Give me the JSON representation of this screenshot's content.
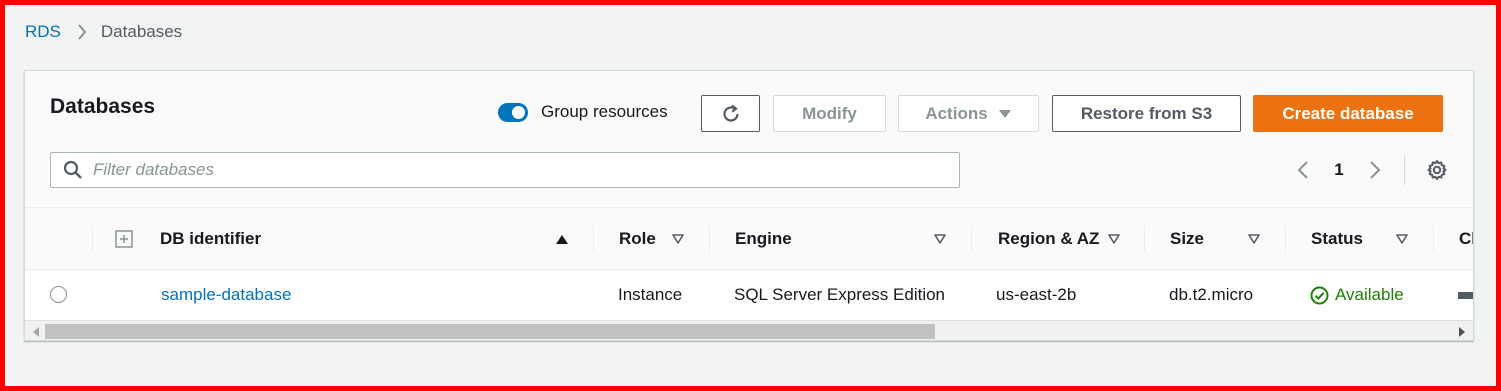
{
  "breadcrumb": {
    "root": "RDS",
    "current": "Databases"
  },
  "panel": {
    "title": "Databases",
    "group_resources_label": "Group resources",
    "group_resources_on": true
  },
  "toolbar": {
    "modify_label": "Modify",
    "actions_label": "Actions",
    "restore_label": "Restore from S3",
    "create_label": "Create database"
  },
  "search": {
    "placeholder": "Filter databases",
    "value": ""
  },
  "pagination": {
    "current_page": "1"
  },
  "table": {
    "columns": {
      "db_identifier": "DB identifier",
      "role": "Role",
      "engine": "Engine",
      "region_az": "Region & AZ",
      "size": "Size",
      "status": "Status",
      "partial": "Cl"
    },
    "rows": [
      {
        "db_identifier": "sample-database",
        "role": "Instance",
        "engine": "SQL Server Express Edition",
        "region_az": "us-east-2b",
        "size": "db.t2.micro",
        "status": "Available"
      }
    ]
  },
  "colors": {
    "accent": "#0073bb",
    "primary_button": "#ec7211",
    "status_ok": "#1d8102",
    "frame": "#ff0000"
  },
  "icons": [
    "chevron-right-icon",
    "toggle-switch",
    "refresh-icon",
    "caret-down-icon",
    "search-icon",
    "chevron-left-icon",
    "gear-icon",
    "expand-icon",
    "sort-ascending-icon",
    "sort-icon",
    "check-circle-icon"
  ]
}
